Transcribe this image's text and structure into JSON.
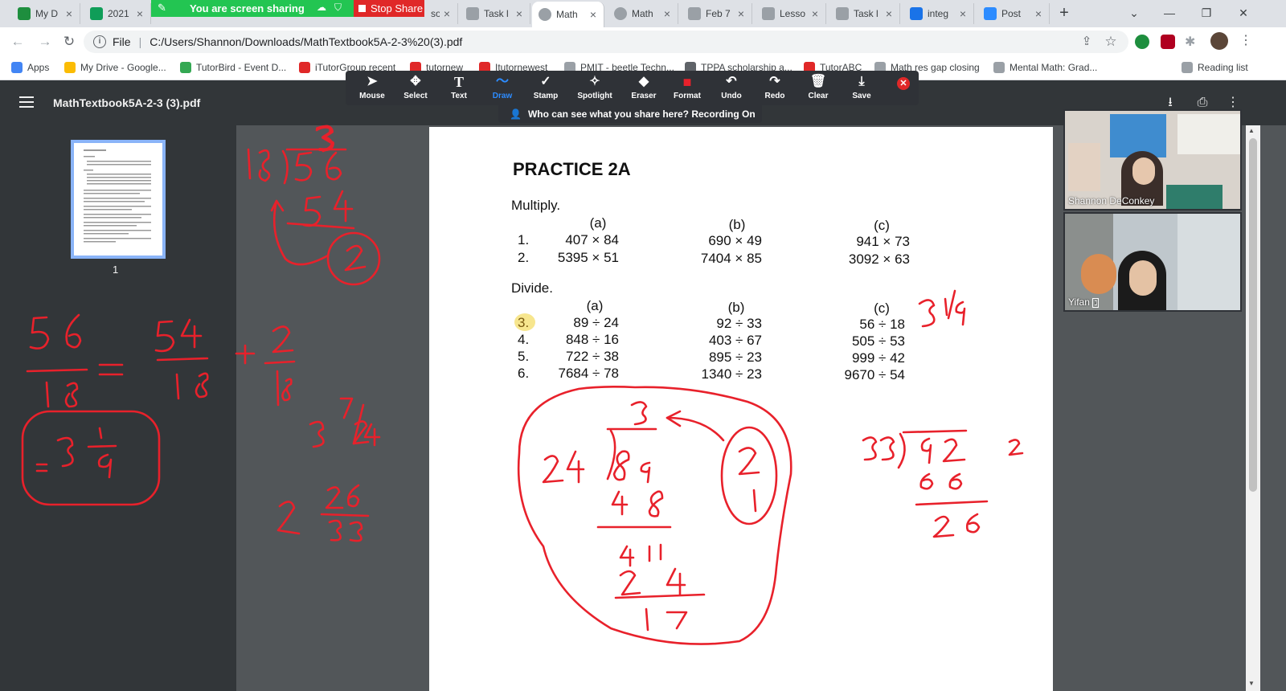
{
  "tabs": [
    {
      "title": "My D",
      "color": "#1e8e3e"
    },
    {
      "title": "2021",
      "color": "#0f9d58"
    },
    {
      "title": "",
      "color": "#4285f4"
    },
    {
      "title": "so",
      "color": "#9aa0a6"
    },
    {
      "title": "Task l",
      "color": "#9aa0a6"
    },
    {
      "title": "Math",
      "color": "#9aa0a6"
    },
    {
      "title": "Math",
      "color": "#9aa0a6"
    },
    {
      "title": "Feb 7",
      "color": "#9aa0a6"
    },
    {
      "title": "Lesso",
      "color": "#9aa0a6"
    },
    {
      "title": "Task l",
      "color": "#9aa0a6"
    },
    {
      "title": "integ",
      "color": "#1a73e8"
    },
    {
      "title": "Post",
      "color": "#2d8cff"
    }
  ],
  "share": {
    "banner_text": "You are screen sharing",
    "stop_label": "Stop Share"
  },
  "toolbar": {
    "url_scheme": "File",
    "url": "C:/Users/Shannon/Downloads/MathTextbook5A-2-3%20(3).pdf"
  },
  "bookmarks": [
    {
      "label": "Apps",
      "color": "#4285f4"
    },
    {
      "label": "My Drive - Google...",
      "color": "#fbbc04"
    },
    {
      "label": "TutorBird - Event D...",
      "color": "#34a853"
    },
    {
      "label": "iTutorGroup recent",
      "color": "#e02828"
    },
    {
      "label": "tutornew",
      "color": "#e02828"
    },
    {
      "label": "Itutornewest",
      "color": "#e02828"
    },
    {
      "label": "PMIT - beetle Techn...",
      "color": "#9aa0a6"
    },
    {
      "label": "TPPA scholarship a...",
      "color": "#5f6368"
    },
    {
      "label": "TutorABC",
      "color": "#e02828"
    },
    {
      "label": "Math res gap closing",
      "color": "#9aa0a6"
    },
    {
      "label": "Mental Math: Grad...",
      "color": "#9aa0a6"
    },
    {
      "label": "Reading list",
      "color": "#9aa0a6"
    }
  ],
  "pdf": {
    "title": "MathTextbook5A-2-3 (3).pdf",
    "thumbnail_page": "1"
  },
  "annotate_tools": [
    {
      "label": "Mouse",
      "icon": "mouse-pointer-icon",
      "glyph": "➤"
    },
    {
      "label": "Select",
      "icon": "move-icon",
      "glyph": "✥"
    },
    {
      "label": "Text",
      "icon": "text-icon",
      "glyph": "T"
    },
    {
      "label": "Draw",
      "icon": "draw-icon",
      "glyph": "〜"
    },
    {
      "label": "Stamp",
      "icon": "stamp-icon",
      "glyph": "✓"
    },
    {
      "label": "Spotlight",
      "icon": "spotlight-icon",
      "glyph": "✧"
    },
    {
      "label": "Eraser",
      "icon": "eraser-icon",
      "glyph": "◆"
    },
    {
      "label": "Format",
      "icon": "format-icon",
      "glyph": "■"
    },
    {
      "label": "Undo",
      "icon": "undo-icon",
      "glyph": "↶"
    },
    {
      "label": "Redo",
      "icon": "redo-icon",
      "glyph": "↷"
    },
    {
      "label": "Clear",
      "icon": "trash-icon",
      "glyph": "🗑"
    },
    {
      "label": "Save",
      "icon": "save-icon",
      "glyph": "⤓"
    }
  ],
  "recording_notice": "Who can see what you share here? Recording On",
  "practice": {
    "title": "PRACTICE 2A",
    "multiply_heading": "Multiply.",
    "divide_heading": "Divide.",
    "col_a": "(a)",
    "col_b": "(b)",
    "col_c": "(c)",
    "multiply_rows": [
      {
        "num": "1.",
        "a": "407 × 84",
        "b": "690 × 49",
        "c": "941 × 73"
      },
      {
        "num": "2.",
        "a": "5395 × 51",
        "b": "7404 × 85",
        "c": "3092 × 63"
      }
    ],
    "divide_rows": [
      {
        "num": "3.",
        "a": "89 ÷ 24",
        "b": "92 ÷ 33",
        "c": "56 ÷ 18"
      },
      {
        "num": "4.",
        "a": "848 ÷ 16",
        "b": "403 ÷ 67",
        "c": "505 ÷ 53"
      },
      {
        "num": "5.",
        "a": "722 ÷ 38",
        "b": "895 ÷ 23",
        "c": "999 ÷ 42"
      },
      {
        "num": "6.",
        "a": "7684 ÷ 78",
        "b": "1340 ÷ 23",
        "c": "9670 ÷ 54"
      }
    ]
  },
  "participants": [
    {
      "name": "Shannon DeConkey"
    },
    {
      "name": "Yifan"
    }
  ],
  "colors": {
    "ink": "#e8212b",
    "highlight": "#f6e27a",
    "share_green": "#23c552",
    "stop_red": "#e02828"
  }
}
